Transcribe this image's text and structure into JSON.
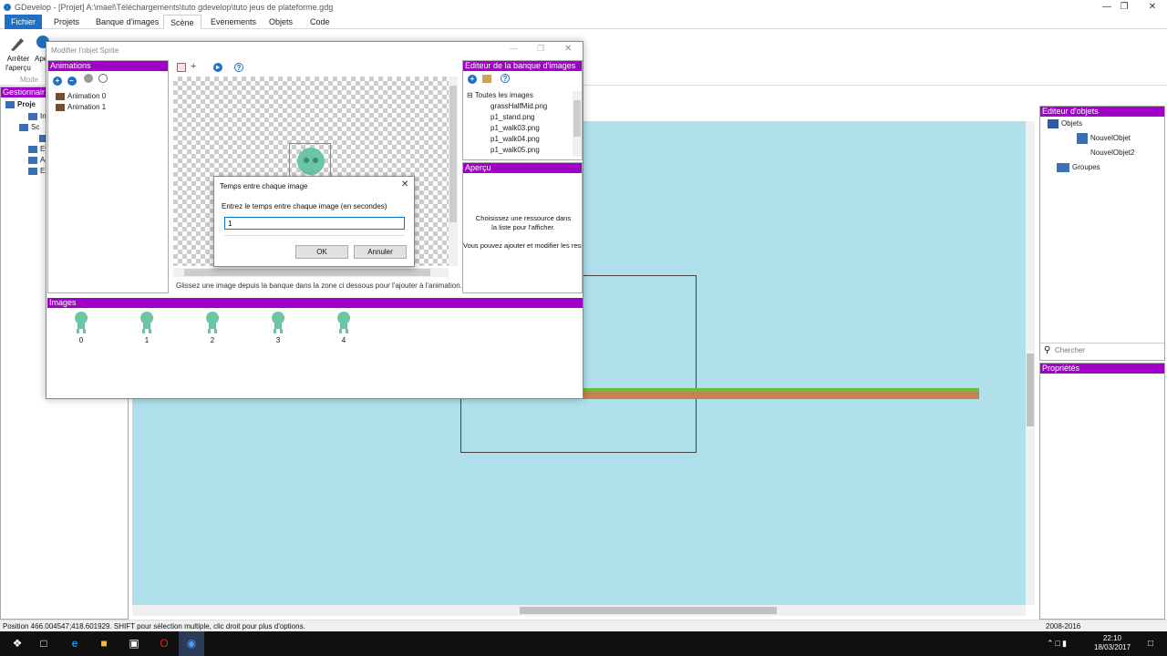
{
  "window": {
    "title": "GDevelop - [Projet] A:\\mael\\Téléchargements\\tuto gdevelop\\tuto jeus de plateforme.gdg"
  },
  "menu": {
    "fichier": "Fichier",
    "projets": "Projets",
    "banque": "Banque d'images",
    "scene": "Scène",
    "evenements": "Evenements",
    "objets": "Objets",
    "code": "Code"
  },
  "ribbon": {
    "stop_line1": "Arrêter",
    "stop_line2": "l'aperçu",
    "ape": "Ape",
    "mode": "Mode"
  },
  "project_manager": {
    "title": "Gestionnair",
    "root": "Proje",
    "items": [
      "In",
      "Sc",
      "",
      "Ev",
      "Ac",
      "Ex"
    ]
  },
  "sprite_editor": {
    "title": "Modifier l'objet Sprite",
    "animations_header": "Animations",
    "animations": [
      "Animation 0",
      "Animation 1"
    ],
    "drop_hint": "Glissez une image depuis la banque dans la zone ci dessous pour l'ajouter à l'animation.",
    "images_header": "Images",
    "frames": [
      "0",
      "1",
      "2",
      "3",
      "4"
    ],
    "bank_header": "Editeur de la banque d'images",
    "bank_root": "Toutes les images",
    "bank_items": [
      "grassHalfMid.png",
      "p1_stand.png",
      "p1_walk03.png",
      "p1_walk04.png",
      "p1_walk05.png"
    ],
    "preview_header": "Aperçu",
    "preview_text1": "Choisissez une ressource dans la liste pour l'afficher.",
    "preview_text2": "Vous pouvez ajouter et modifier les ressources avec la barre d'o"
  },
  "dialog": {
    "title": "Temps entre chaque image",
    "label": "Entrez le temps entre chaque image (en secondes)",
    "value": "1",
    "ok": "OK",
    "cancel": "Annuler"
  },
  "objects_editor": {
    "title": "Editeur d'objets",
    "root": "Objets",
    "items": [
      "NouvelObjet",
      "NouvelObjet2"
    ],
    "groups": "Groupes",
    "search_placeholder": "Chercher"
  },
  "properties": {
    "title": "Propriétés"
  },
  "status": {
    "text": "Position 466.004547;418.601929. SHIFT pour sélection multiple, clic droit pour plus d'options.",
    "years": "2008-2016"
  },
  "clock": {
    "time": "22:10",
    "date": "18/03/2017"
  },
  "colors": {
    "accent": "#a000c8",
    "scene_bg": "#b0e0ec",
    "char": "#6cc5a4"
  }
}
